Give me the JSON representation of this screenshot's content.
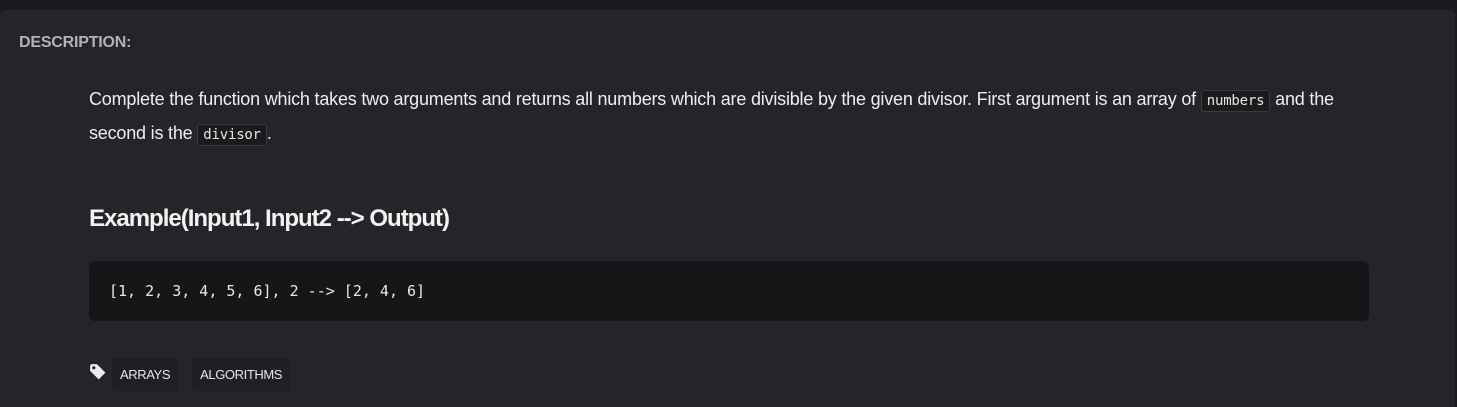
{
  "section_label": "DESCRIPTION:",
  "description": {
    "text_1": "Complete the function which takes two arguments and returns all numbers which are divisible by the given divisor. First argument is an array of ",
    "code_1": "numbers",
    "text_2": " and the second is the ",
    "code_2": "divisor",
    "text_3": "."
  },
  "example": {
    "heading": "Example(Input1, Input2 --> Output)",
    "code": "[1, 2, 3, 4, 5, 6], 2 --> [2, 4, 6]"
  },
  "tags": {
    "icon": "tag-icon",
    "items": [
      "ARRAYS",
      "ALGORITHMS"
    ]
  },
  "colors": {
    "background": "#1b1b1e",
    "panel": "#242529",
    "code_block": "#161618"
  }
}
